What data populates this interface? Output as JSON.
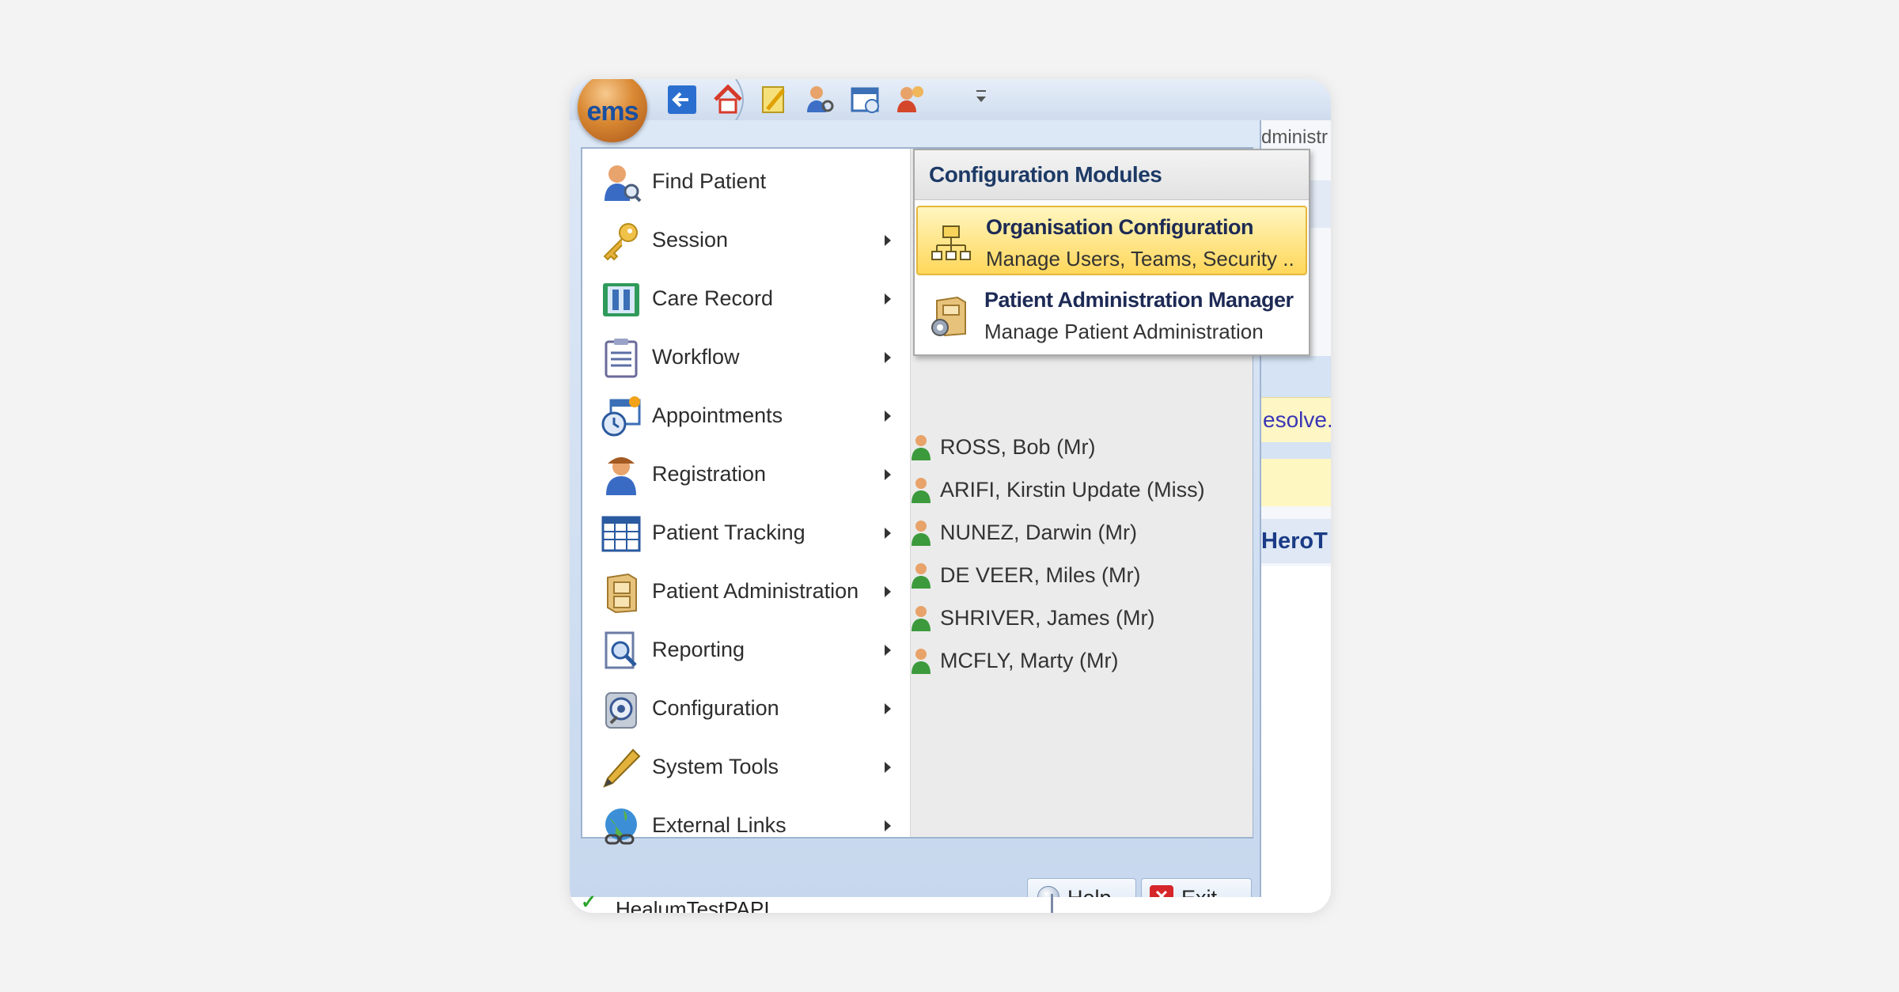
{
  "app": {
    "logo_text": "ems"
  },
  "quick_access": {
    "buttons": [
      "back-icon",
      "home-icon",
      "notepad-icon",
      "find-user-icon",
      "calendar-icon",
      "user-group-icon"
    ],
    "more_icon": "customize-dropdown-icon"
  },
  "background": {
    "top_text": "dministr",
    "banner_text": "esolve.",
    "band_text": "HeroT",
    "bottom_list_item": "HealumTestPAPI"
  },
  "menu": {
    "items": [
      {
        "label": "Find Patient",
        "icon": "find-patient-icon",
        "has_submenu": false
      },
      {
        "label": "Session",
        "icon": "key-icon",
        "has_submenu": true
      },
      {
        "label": "Care Record",
        "icon": "care-record-icon",
        "has_submenu": true
      },
      {
        "label": "Workflow",
        "icon": "clipboard-icon",
        "has_submenu": true
      },
      {
        "label": "Appointments",
        "icon": "calendar-clock-icon",
        "has_submenu": true
      },
      {
        "label": "Registration",
        "icon": "user-icon",
        "has_submenu": true
      },
      {
        "label": "Patient Tracking",
        "icon": "grid-icon",
        "has_submenu": true
      },
      {
        "label": "Patient Administration",
        "icon": "cabinet-icon",
        "has_submenu": true
      },
      {
        "label": "Reporting",
        "icon": "report-icon",
        "has_submenu": true
      },
      {
        "label": "Configuration",
        "icon": "gear-magnifier-icon",
        "has_submenu": true
      },
      {
        "label": "System Tools",
        "icon": "pencil-icon",
        "has_submenu": true
      },
      {
        "label": "External Links",
        "icon": "globe-icon",
        "has_submenu": true
      }
    ]
  },
  "recent_patients": [
    "ROSS, Bob (Mr)",
    "ARIFI, Kirstin Update (Miss)",
    "NUNEZ, Darwin (Mr)",
    "DE VEER, Miles (Mr)",
    "SHRIVER, James (Mr)",
    "MCFLY, Marty (Mr)"
  ],
  "submenu": {
    "header": "Configuration Modules",
    "items": [
      {
        "title": "Organisation Configuration",
        "description": "Manage Users, Teams, Security ..",
        "icon": "org-chart-icon",
        "active": true
      },
      {
        "title": "Patient Administration Manager",
        "description": "Manage Patient Administration",
        "icon": "cabinet-gear-icon",
        "active": false
      }
    ]
  },
  "footer": {
    "help_label": "Help",
    "exit_label": "Exit"
  },
  "colors": {
    "accent": "#1d3a66",
    "highlight": "#ffd75a",
    "exit": "#d6262a",
    "frame": "#c7d8ee"
  }
}
